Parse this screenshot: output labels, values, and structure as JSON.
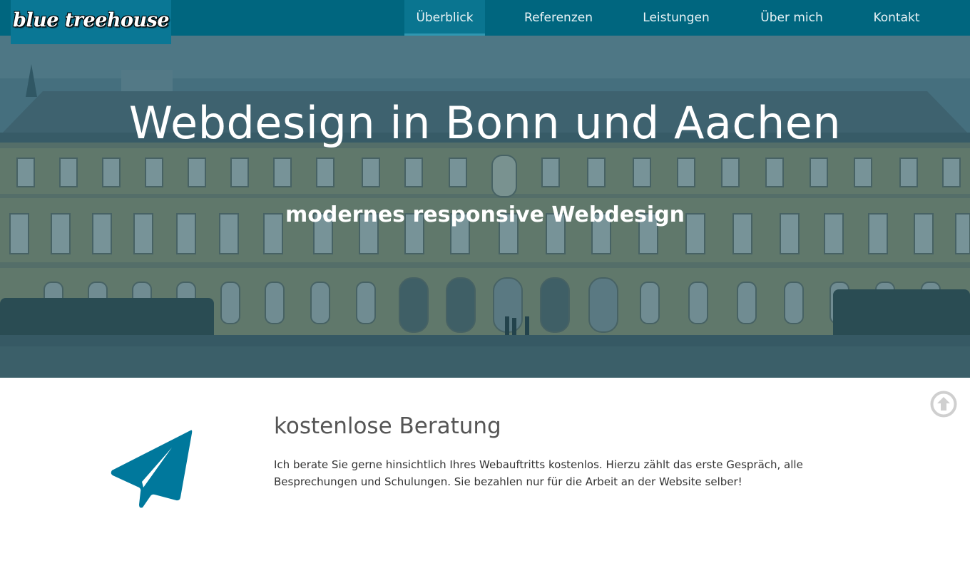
{
  "brand": {
    "logo_text": "blue treehouse"
  },
  "nav": {
    "items": [
      {
        "label": "Überblick",
        "active": true
      },
      {
        "label": "Referenzen",
        "active": false
      },
      {
        "label": "Leistungen",
        "active": false
      },
      {
        "label": "Über mich",
        "active": false
      },
      {
        "label": "Kontakt",
        "active": false
      }
    ]
  },
  "hero": {
    "title": "Webdesign in Bonn und Aachen",
    "subtitle": "modernes responsive Webdesign"
  },
  "feature": {
    "icon": "paper-plane-icon",
    "title": "kostenlose Beratung",
    "text": "Ich berate Sie gerne hinsichtlich Ihres Webauftritts kostenlos. Hierzu zählt das erste Gespräch, alle Besprechungen und Schulungen. Sie bezahlen nur für die Arbeit an der Website selber!"
  },
  "scroll_top": {
    "icon": "arrow-up-circle-icon"
  },
  "colors": {
    "navbar": "#00667f",
    "logo_bg": "#0a7795",
    "accent": "#00789c",
    "hero_overlay": "#265868"
  }
}
